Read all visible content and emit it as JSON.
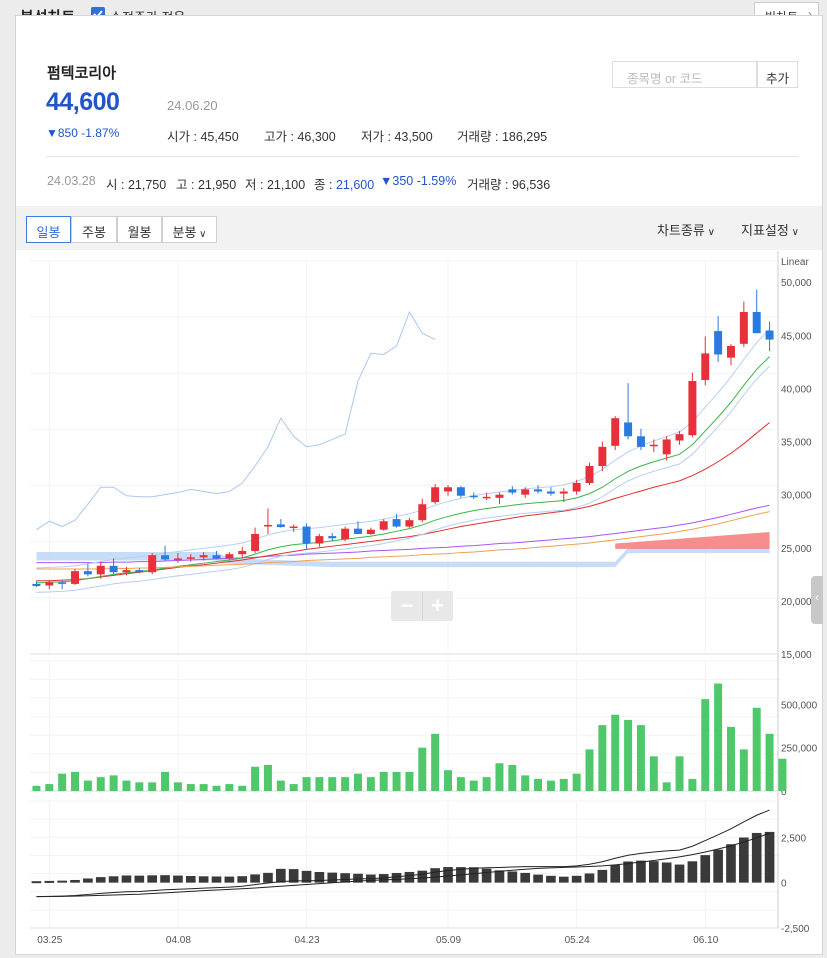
{
  "header": {
    "title": "분석차트",
    "adjusted_price_label": "수정주가 적용",
    "adjusted_price_checked": true,
    "big_chart_label": "빅차트"
  },
  "stock": {
    "name": "펌텍코리아",
    "price": "44,600",
    "date": "24.06.20",
    "change": "▼850 -1.87%",
    "open_label": "시가",
    "open_value": "45,450",
    "high_label": "고가",
    "high_value": "46,300",
    "low_label": "저가",
    "low_value": "43,500",
    "volume_label": "거래량",
    "volume_value": "186,295"
  },
  "search": {
    "placeholder": "종목명 or 코드",
    "add_label": "추가"
  },
  "hover": {
    "date": "24.03.28",
    "open_label": "시",
    "open_value": "21,750",
    "high_label": "고",
    "high_value": "21,950",
    "low_label": "저",
    "low_value": "21,100",
    "close_label": "종",
    "close_value": "21,600",
    "change": "▼350 -1.59%",
    "volume_label": "거래량",
    "volume_value": "96,536"
  },
  "tabs": [
    {
      "label": "일봉",
      "active": true
    },
    {
      "label": "주봉",
      "active": false
    },
    {
      "label": "월봉",
      "active": false
    },
    {
      "label": "분봉",
      "active": false
    }
  ],
  "dropdowns": {
    "chart_type": "차트종류",
    "indicator": "지표설정"
  },
  "colors": {
    "up": "#e8303a",
    "down": "#2a7be0",
    "volume": "#4ec86b",
    "accent": "#2d6fdb"
  },
  "chart_data": {
    "type": "candlestick",
    "price_axis": {
      "label": "Linear",
      "ticks": [
        "50,000",
        "45,000",
        "40,000",
        "35,000",
        "30,000",
        "25,000",
        "20,000",
        "15,000"
      ],
      "ylim": [
        15000,
        52000
      ]
    },
    "volume_axis": {
      "ticks": [
        "500,000",
        "250,000",
        "0"
      ],
      "ylim": [
        0,
        750000
      ]
    },
    "macd_axis": {
      "ticks": [
        "2,500",
        "0",
        "-2,500"
      ],
      "ylim": [
        -2500,
        4500
      ]
    },
    "x_ticks": [
      "03.25",
      "04.08",
      "04.23",
      "05.09",
      "05.24",
      "06.10"
    ],
    "candles": [
      {
        "o": 21600,
        "h": 21900,
        "l": 21300,
        "c": 21400
      },
      {
        "o": 21450,
        "h": 21950,
        "l": 21100,
        "c": 21750
      },
      {
        "o": 21750,
        "h": 21950,
        "l": 21100,
        "c": 21600
      },
      {
        "o": 21600,
        "h": 23000,
        "l": 21500,
        "c": 22800
      },
      {
        "o": 22800,
        "h": 23500,
        "l": 22300,
        "c": 22500
      },
      {
        "o": 22500,
        "h": 23700,
        "l": 22100,
        "c": 23300
      },
      {
        "o": 23300,
        "h": 24000,
        "l": 22500,
        "c": 22700
      },
      {
        "o": 22700,
        "h": 23200,
        "l": 22400,
        "c": 22900
      },
      {
        "o": 22900,
        "h": 23100,
        "l": 22600,
        "c": 22700
      },
      {
        "o": 22700,
        "h": 24500,
        "l": 22500,
        "c": 24300
      },
      {
        "o": 24300,
        "h": 25200,
        "l": 23800,
        "c": 23900
      },
      {
        "o": 23900,
        "h": 24500,
        "l": 23600,
        "c": 24000
      },
      {
        "o": 24000,
        "h": 24400,
        "l": 23700,
        "c": 24100
      },
      {
        "o": 24100,
        "h": 24600,
        "l": 23800,
        "c": 24300
      },
      {
        "o": 24300,
        "h": 24700,
        "l": 23900,
        "c": 24000
      },
      {
        "o": 24000,
        "h": 24600,
        "l": 23800,
        "c": 24400
      },
      {
        "o": 24400,
        "h": 25100,
        "l": 24000,
        "c": 24700
      },
      {
        "o": 24700,
        "h": 26900,
        "l": 24500,
        "c": 26300
      },
      {
        "o": 27100,
        "h": 28700,
        "l": 26300,
        "c": 27150
      },
      {
        "o": 27200,
        "h": 27700,
        "l": 26900,
        "c": 26950
      },
      {
        "o": 26900,
        "h": 27200,
        "l": 26500,
        "c": 27000
      },
      {
        "o": 27000,
        "h": 27300,
        "l": 24900,
        "c": 25400
      },
      {
        "o": 25400,
        "h": 26300,
        "l": 25100,
        "c": 26100
      },
      {
        "o": 26100,
        "h": 26400,
        "l": 25600,
        "c": 25900
      },
      {
        "o": 25800,
        "h": 27000,
        "l": 25600,
        "c": 26800
      },
      {
        "o": 26800,
        "h": 27500,
        "l": 26300,
        "c": 26300
      },
      {
        "o": 26300,
        "h": 26900,
        "l": 26200,
        "c": 26700
      },
      {
        "o": 26700,
        "h": 27700,
        "l": 26600,
        "c": 27500
      },
      {
        "o": 27700,
        "h": 28200,
        "l": 26900,
        "c": 27000
      },
      {
        "o": 27000,
        "h": 27800,
        "l": 26900,
        "c": 27600
      },
      {
        "o": 27600,
        "h": 29600,
        "l": 27400,
        "c": 29100
      },
      {
        "o": 29300,
        "h": 31000,
        "l": 29100,
        "c": 30700
      },
      {
        "o": 30300,
        "h": 30900,
        "l": 29900,
        "c": 30700
      },
      {
        "o": 30700,
        "h": 30800,
        "l": 29700,
        "c": 29900
      },
      {
        "o": 29900,
        "h": 30200,
        "l": 29600,
        "c": 29800
      },
      {
        "o": 29800,
        "h": 30200,
        "l": 29500,
        "c": 29800
      },
      {
        "o": 29700,
        "h": 30200,
        "l": 29100,
        "c": 30000
      },
      {
        "o": 30500,
        "h": 30800,
        "l": 30000,
        "c": 30200
      },
      {
        "o": 30000,
        "h": 30700,
        "l": 29700,
        "c": 30500
      },
      {
        "o": 30500,
        "h": 30900,
        "l": 30100,
        "c": 30300
      },
      {
        "o": 30300,
        "h": 30700,
        "l": 29900,
        "c": 30100
      },
      {
        "o": 30100,
        "h": 30600,
        "l": 29300,
        "c": 30300
      },
      {
        "o": 30300,
        "h": 31400,
        "l": 30000,
        "c": 31100
      },
      {
        "o": 31100,
        "h": 33000,
        "l": 30900,
        "c": 32700
      },
      {
        "o": 32700,
        "h": 35000,
        "l": 32200,
        "c": 34500
      },
      {
        "o": 34600,
        "h": 37400,
        "l": 34200,
        "c": 37200
      },
      {
        "o": 36800,
        "h": 40500,
        "l": 35200,
        "c": 35500
      },
      {
        "o": 35500,
        "h": 36200,
        "l": 34200,
        "c": 34500
      },
      {
        "o": 34600,
        "h": 35200,
        "l": 34000,
        "c": 34700
      },
      {
        "o": 33800,
        "h": 35500,
        "l": 33200,
        "c": 35200
      },
      {
        "o": 35100,
        "h": 36000,
        "l": 34700,
        "c": 35700
      },
      {
        "o": 35600,
        "h": 41500,
        "l": 35400,
        "c": 40700
      },
      {
        "o": 40800,
        "h": 44900,
        "l": 40300,
        "c": 43300
      },
      {
        "o": 45400,
        "h": 46800,
        "l": 42500,
        "c": 43200
      },
      {
        "o": 42900,
        "h": 44200,
        "l": 42200,
        "c": 44000
      },
      {
        "o": 44200,
        "h": 48200,
        "l": 43900,
        "c": 47200
      },
      {
        "o": 47200,
        "h": 49300,
        "l": 45300,
        "c": 45200
      },
      {
        "o": 45450,
        "h": 46300,
        "l": 43500,
        "c": 44600
      }
    ],
    "volume": [
      30000,
      40000,
      100000,
      110000,
      60000,
      80000,
      90000,
      60000,
      50000,
      50000,
      110000,
      50000,
      40000,
      40000,
      30000,
      40000,
      30000,
      140000,
      150000,
      60000,
      40000,
      80000,
      80000,
      80000,
      80000,
      100000,
      80000,
      110000,
      110000,
      110000,
      250000,
      330000,
      120000,
      80000,
      60000,
      80000,
      160000,
      150000,
      90000,
      70000,
      60000,
      70000,
      100000,
      240000,
      380000,
      440000,
      410000,
      380000,
      200000,
      50000,
      200000,
      70000,
      530000,
      620000,
      370000,
      240000,
      480000,
      330000,
      186295
    ],
    "ma_fast": [
      21700,
      21750,
      21800,
      21900,
      22100,
      22300,
      22500,
      22650,
      22750,
      22900,
      23100,
      23250,
      23400,
      23550,
      23700,
      23850,
      24050,
      24400,
      24800,
      25100,
      25300,
      25400,
      25500,
      25650,
      25800,
      25950,
      26100,
      26300,
      26550,
      26800,
      27150,
      27600,
      27950,
      28250,
      28500,
      28700,
      28850,
      29000,
      29150,
      29250,
      29350,
      29450,
      29700,
      30100,
      30700,
      31500,
      32200,
      32700,
      33100,
      33450,
      33800,
      34700,
      36000,
      37300,
      38700,
      40300,
      41800,
      43000
    ],
    "ma_mid": [
      21900,
      21900,
      21950,
      22000,
      22100,
      22250,
      22400,
      22550,
      22700,
      22850,
      23000,
      23150,
      23300,
      23400,
      23550,
      23700,
      23850,
      24050,
      24250,
      24450,
      24650,
      24850,
      25000,
      25150,
      25300,
      25450,
      25600,
      25750,
      25900,
      26050,
      26250,
      26500,
      26750,
      27000,
      27200,
      27400,
      27600,
      27800,
      28000,
      28150,
      28300,
      28450,
      28650,
      28900,
      29250,
      29650,
      30000,
      30350,
      30700,
      31000,
      31300,
      31800,
      32400,
      33100,
      33900,
      34800,
      35800,
      36800
    ],
    "ma_slow": [
      23600,
      23600,
      23600,
      23600,
      23600,
      23600,
      23650,
      23650,
      23700,
      23700,
      23750,
      23800,
      23850,
      23900,
      23950,
      24000,
      24050,
      24100,
      24200,
      24250,
      24300,
      24400,
      24450,
      24500,
      24550,
      24600,
      24700,
      24750,
      24800,
      24850,
      24950,
      25000,
      25050,
      25150,
      25200,
      25300,
      25400,
      25450,
      25550,
      25650,
      25750,
      25850,
      25950,
      26050,
      26200,
      26350,
      26500,
      26650,
      26800,
      26950,
      27150,
      27350,
      27600,
      27850,
      28150,
      28450,
      28750,
      29000
    ]
  }
}
